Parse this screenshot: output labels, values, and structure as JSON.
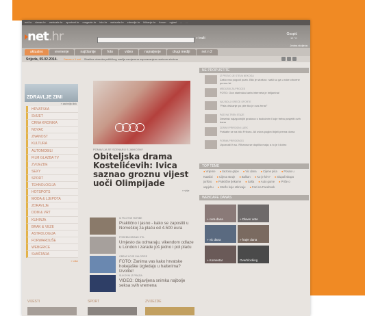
{
  "top_strip": [
    "net.hr",
    "danas.hr",
    "webcafe.hr",
    "sportnet.hr",
    "magazin.hr",
    "tvin.hr",
    "webcafe.hr",
    "zdravlje.hr",
    "klikanje.hr",
    "forum",
    "oglasi",
    "...",
    "..."
  ],
  "logo": {
    "text": "net",
    "suffix": ".hr"
  },
  "search": {
    "placeholder": "",
    "button": "» traži"
  },
  "weather": {
    "city": "Gospić",
    "temp": "12 °C"
  },
  "login": "Jedna stoljeća",
  "nav": [
    "aktualno",
    "vremenje",
    "najčitanije",
    "foto",
    "video",
    "najnaljenje",
    "drugi mediji",
    "net n 2"
  ],
  "datebar": {
    "date": "Srijeda, 05.02.2014.",
    "ticker_label": "Danas u 1 sat",
    "headline": "Strašina okrenka političkog nasilja usmjerena osporavanjem nazivom slovima",
    "icons": [
      "rss-icon",
      "twitter-icon",
      "facebook-icon"
    ]
  },
  "left": {
    "promo": "ZDRAVLJE ZIMI",
    "sub": "» zanimljivi link",
    "categories": [
      "HRVATSKA",
      "SVIJET",
      "CRNA KRONIKA",
      "NOVAC",
      "ZNANOST",
      "KULTURA",
      "AUTOMOBILI",
      "FILM GLAZBA TV",
      "ZVIJEZDE",
      "SEXY",
      "SPORT",
      "TEHNOLOGIJA",
      "HOTSPOTS",
      "MODA & LJEPOTA",
      "ZDRAVLJE",
      "DOM & VRT",
      "KUHINJA",
      "BRAK & VEZE",
      "ASTROLOGIJA",
      "FORWARDUŠE",
      "WEBGRICE",
      "SVAŠTARA"
    ],
    "more": "» više"
  },
  "main": {
    "kicker": "PONAVLJA SE SCENARIJ S JANICOM?",
    "headline": "Obiteljska drama Kostelićevih: Ivica saznao groznu vijest uoči Olimpijade",
    "more": "» više",
    "articles": [
      {
        "kicker": "IZ PILOTNE HORIBE",
        "title": "Praktično i jasno - kako se zaposliti u Norveškoj za plaću od 4.500 eura",
        "thumb": "#8a7a6a"
      },
      {
        "kicker": "POSEBNI BRAND STIL",
        "title": "Umjesto da odmaraju, vikendom odlaze u London i zarade još jedno i pol plaću",
        "thumb": "#a6a09c"
      },
      {
        "kicker": "OBRAZ KOJE GALOPIRE",
        "title": "FOTO: Zanima vas kako hrvatske hokejaške izgledaju u halterima? Izvolite!",
        "thumb": "#6a88b0"
      },
      {
        "kicker": "SLIKOVNI IZ PRAZIA",
        "title": "VIDEO: Objavljena snimka najbolje seksa svih vremena",
        "thumb": "#2e3e66"
      }
    ]
  },
  "right": {
    "header": "NE PROPUSTITE",
    "items": [
      {
        "kicker": "IZ PROVO JE STEVA NEKOGA",
        "title": "Zašto nas pogodi poziv. Bilo je strašno: našli su ga u ruke crkvene prema Isi"
      },
      {
        "kicker": "MEDIJSKI ZA PROCES",
        "title": "FOTO: Ova starinska karta interneta je briljantna!"
      },
      {
        "kicker": "NAJ BOLJI SREĆE SPORTE",
        "title": "\"Pala dršćanje po pite tko je ova žena!\""
      },
      {
        "kicker": "PAZI NA TREN STAZE",
        "title": "Desetak najzgodnijih gradova s budućnim i koje treba posjetiti ovih dana"
      },
      {
        "kicker": "ZDRAVI PRIRODNI LIJEK",
        "title": "Poštalte se na bilo Friboru. Ali ovina pogled bijeli prema doma"
      },
      {
        "kicker": "FORMA PRIRODNOG",
        "title": "Upoznali ih su. Rihanna se dopilila maja; a to je i dobro"
      }
    ],
    "teme_header": "TOP TEME",
    "teme": [
      "Vrijeme",
      "Sezona gripe",
      "Vic dana",
      "Cijene pića",
      "Posao u Katalizi",
      "Cijena struje",
      "Balkan",
      "Ko je kriv?",
      "Slupali skupo jurišno",
      "Praktične ljekarne",
      "Saša",
      "Auto gume",
      "Priče o uspjehu",
      "Mreže koje otkrivaju",
      "Fazi na Facebook"
    ],
    "webcafe_header": "WEBCAFE DANAS",
    "tiles": [
      "» cura dana",
      "» Dlaver ante",
      "» vic dana",
      "» frajer dana",
      "» Komentar",
      "Overblocking"
    ]
  },
  "bottom": {
    "vijesti": "VIJESTI",
    "sport": "SPORT",
    "zvijezde": "ZVIJEZDE"
  }
}
